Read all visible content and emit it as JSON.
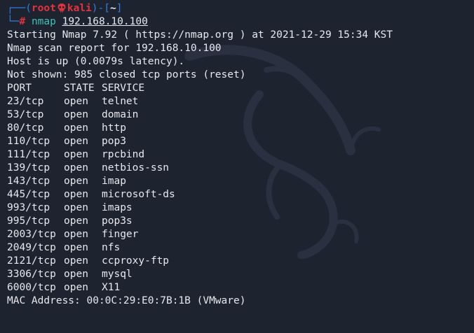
{
  "prompt": {
    "open_bracket": "┌──(",
    "user": "root",
    "host": "kali",
    "mid": ")-[",
    "dir": "~",
    "close_bracket": "]",
    "line2_prefix": "└─",
    "hash": "#",
    "command": "nmap",
    "argument": "192.168.10.100"
  },
  "output_header": [
    "Starting Nmap 7.92 ( https://nmap.org ) at 2021-12-29 15:34 KST",
    "Nmap scan report for 192.168.10.100",
    "Host is up (0.0079s latency).",
    "Not shown: 985 closed tcp ports (reset)"
  ],
  "table": {
    "headers": [
      "PORT",
      "STATE",
      "SERVICE"
    ],
    "rows": [
      [
        "23/tcp",
        "open",
        "telnet"
      ],
      [
        "53/tcp",
        "open",
        "domain"
      ],
      [
        "80/tcp",
        "open",
        "http"
      ],
      [
        "110/tcp",
        "open",
        "pop3"
      ],
      [
        "111/tcp",
        "open",
        "rpcbind"
      ],
      [
        "139/tcp",
        "open",
        "netbios-ssn"
      ],
      [
        "143/tcp",
        "open",
        "imap"
      ],
      [
        "445/tcp",
        "open",
        "microsoft-ds"
      ],
      [
        "993/tcp",
        "open",
        "imaps"
      ],
      [
        "995/tcp",
        "open",
        "pop3s"
      ],
      [
        "2003/tcp",
        "open",
        "finger"
      ],
      [
        "2049/tcp",
        "open",
        "nfs"
      ],
      [
        "2121/tcp",
        "open",
        "ccproxy-ftp"
      ],
      [
        "3306/tcp",
        "open",
        "mysql"
      ],
      [
        "6000/tcp",
        "open",
        "X11"
      ]
    ]
  },
  "mac_line": "MAC Address: 00:0C:29:E0:7B:1B (VMware)",
  "colors": {
    "background": "#1e2330",
    "prompt_blue": "#2f7ee0",
    "root_red": "#e0333d",
    "command_teal": "#3fc2b8",
    "text": "#e6e9ef"
  },
  "icons": {
    "skull": "skull-icon",
    "background_logo": "kali-dragon-watermark"
  }
}
